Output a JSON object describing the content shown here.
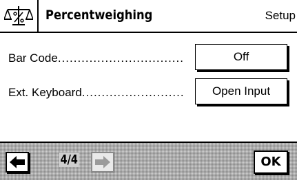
{
  "header": {
    "app_icon": "percent-weighing-scale-icon",
    "title": "Percentweighing",
    "view_label": "Setup"
  },
  "settings": [
    {
      "label": "Bar Code",
      "dots": "................................",
      "value": "Off"
    },
    {
      "label": "Ext. Keyboard",
      "dots": "..........................",
      "value": "Open Input"
    }
  ],
  "footer": {
    "prev_icon": "arrow-left-icon",
    "page_indicator": "4/4",
    "next_icon": "arrow-right-icon",
    "next_enabled": false,
    "ok_label": "OK"
  },
  "colors": {
    "foreground": "#000000",
    "background": "#ffffff",
    "footer_pattern": "#cfcfcf",
    "disabled_arrow": "#9a9a9a"
  }
}
